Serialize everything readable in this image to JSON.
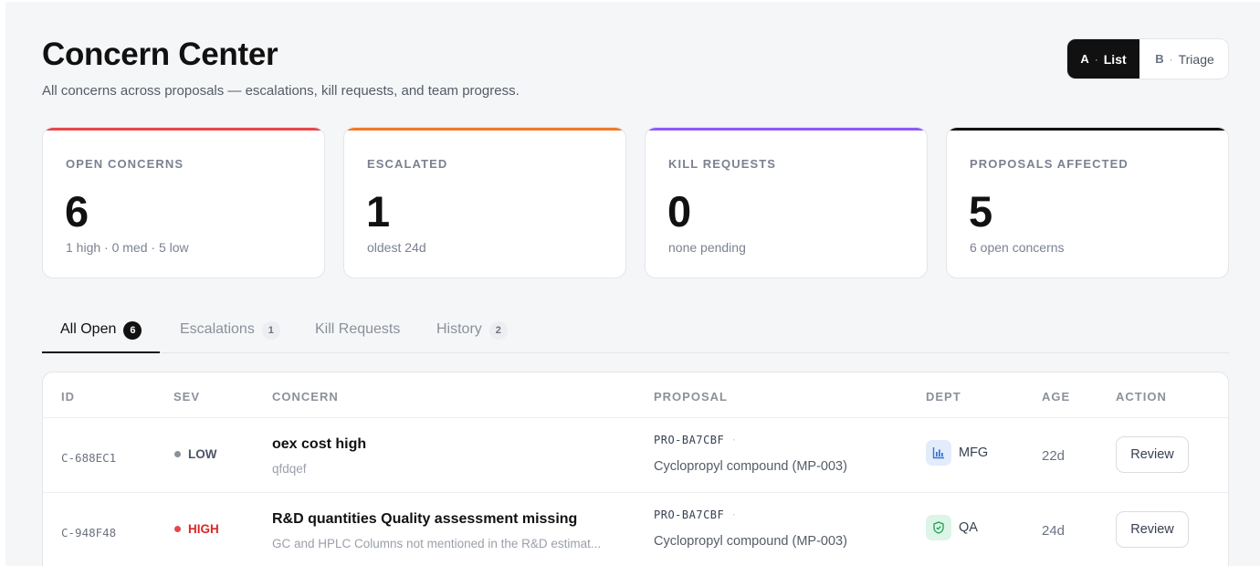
{
  "header": {
    "title": "Concern Center",
    "subtitle": "All concerns across proposals — escalations, kill requests, and team progress."
  },
  "view_toggle": {
    "options": [
      {
        "key": "A",
        "label": "List",
        "active": true
      },
      {
        "key": "B",
        "label": "Triage",
        "active": false
      }
    ],
    "separator": "·"
  },
  "stats": [
    {
      "label": "OPEN CONCERNS",
      "value": "6",
      "sub": "1 high · 0 med · 5 low",
      "accent": "#e5484d"
    },
    {
      "label": "ESCALATED",
      "value": "1",
      "sub": "oldest 24d",
      "accent": "#f07a2a"
    },
    {
      "label": "KILL REQUESTS",
      "value": "0",
      "sub": "none pending",
      "accent": "#8b5cf6"
    },
    {
      "label": "PROPOSALS AFFECTED",
      "value": "5",
      "sub": "6 open concerns",
      "accent": "#111111"
    }
  ],
  "tabs": [
    {
      "label": "All Open",
      "count": "6",
      "active": true
    },
    {
      "label": "Escalations",
      "count": "1",
      "active": false
    },
    {
      "label": "Kill Requests",
      "count": "",
      "active": false
    },
    {
      "label": "History",
      "count": "2",
      "active": false
    }
  ],
  "table": {
    "columns": [
      "ID",
      "SEV",
      "CONCERN",
      "PROPOSAL",
      "DEPT",
      "AGE",
      "ACTION"
    ],
    "rows": [
      {
        "id": "C-688EC1",
        "severity": "LOW",
        "severity_color": "#4b5563",
        "severity_dot": "#8b909a",
        "title": "oex cost high",
        "description": "qfdqef",
        "proposal_id": "PRO-BA7CBF",
        "proposal_sep": "·",
        "proposal_name": "Cyclopropyl compound (MP-003)",
        "dept": "MFG",
        "dept_icon": "bar-chart-icon",
        "age": "22d",
        "action": "Review"
      },
      {
        "id": "C-948F48",
        "severity": "HIGH",
        "severity_color": "#dc2626",
        "severity_dot": "#e5484d",
        "title": "R&D quantities Quality assessment missing",
        "description": "GC and HPLC Columns not mentioned in the R&D estimat...",
        "proposal_id": "PRO-BA7CBF",
        "proposal_sep": "·",
        "proposal_name": "Cyclopropyl compound (MP-003)",
        "dept": "QA",
        "dept_icon": "shield-check-icon",
        "age": "24d",
        "action": "Review"
      }
    ]
  }
}
